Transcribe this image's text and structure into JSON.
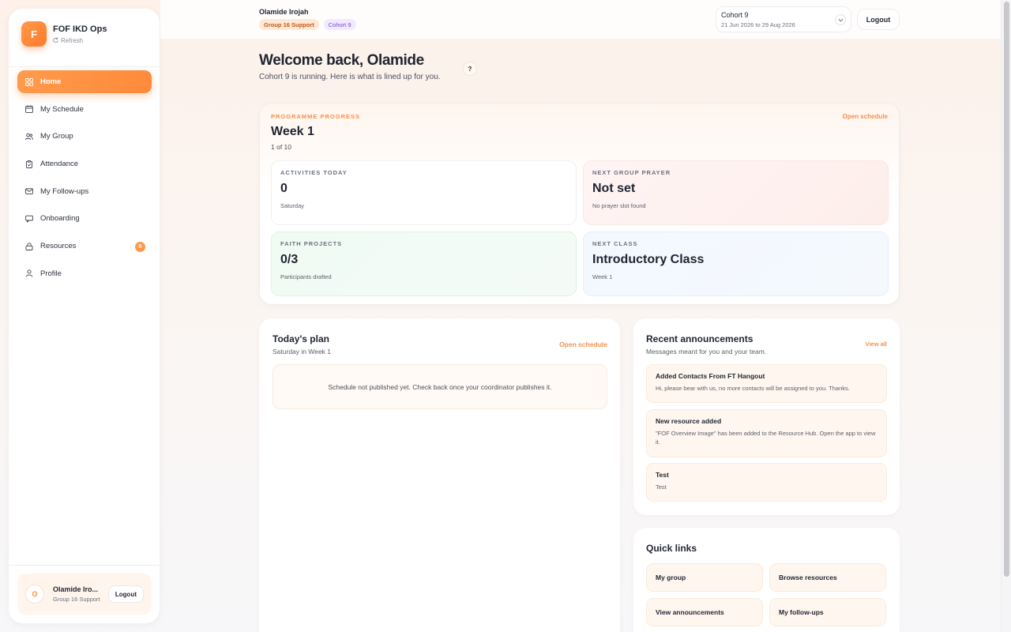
{
  "brand": {
    "logo_letter": "F",
    "name": "FOF IKD Ops",
    "refresh_label": "Refresh"
  },
  "sidebar": {
    "items": [
      {
        "label": "Home",
        "icon": "grid-icon",
        "active": true
      },
      {
        "label": "My Schedule",
        "icon": "calendar-icon"
      },
      {
        "label": "My Group",
        "icon": "users-icon"
      },
      {
        "label": "Attendance",
        "icon": "clipboard-icon"
      },
      {
        "label": "My Follow-ups",
        "icon": "mail-icon"
      },
      {
        "label": "Onboarding",
        "icon": "chat-icon"
      },
      {
        "label": "Resources",
        "icon": "lock-icon",
        "badge": "6"
      },
      {
        "label": "Profile",
        "icon": "person-icon"
      }
    ]
  },
  "sidebar_user": {
    "avatar": "O",
    "name": "Olamide Iro...",
    "role": "Group 16 Support",
    "logout_label": "Logout"
  },
  "header": {
    "user_name": "Olamide Irojah",
    "group_chip": "Group 16 Support",
    "cohort_chip": "Cohort 9",
    "cohort_select": {
      "name": "Cohort 9",
      "dates": "21 Jun 2026 to 29 Aug 2026"
    },
    "logout_label": "Logout"
  },
  "welcome": {
    "title": "Welcome back, Olamide",
    "subtitle": "Cohort 9 is running. Here is what is lined up for you.",
    "help": "?"
  },
  "progress": {
    "eyebrow": "PROGRAMME PROGRESS",
    "week": "Week 1",
    "count": "1 of 10",
    "link": "Open schedule",
    "stats": [
      {
        "label": "ACTIVITIES TODAY",
        "value": "0",
        "note": "Saturday"
      },
      {
        "label": "NEXT GROUP PRAYER",
        "value": "Not set",
        "note": "No prayer slot found"
      },
      {
        "label": "FAITH PROJECTS",
        "value": "0/3",
        "note": "Participants drafted"
      },
      {
        "label": "NEXT CLASS",
        "value": "Introductory Class",
        "note": "Week 1"
      }
    ]
  },
  "plan": {
    "title": "Today's plan",
    "subtitle": "Saturday in Week 1",
    "link": "Open schedule",
    "empty": "Schedule not published yet. Check back once your coordinator publishes it."
  },
  "announcements": {
    "title": "Recent announcements",
    "subtitle": "Messages meant for you and your team.",
    "link": "View all",
    "items": [
      {
        "title": "Added Contacts From FT Hangout",
        "body": "Hi, please bear with us, no more contacts will be assigned to you. Thanks."
      },
      {
        "title": "New resource added",
        "body": "\"FOF Overview Image\" has been added to the Resource Hub. Open the app to view it."
      },
      {
        "title": "Test",
        "body": "Test"
      }
    ]
  },
  "quick_links": {
    "title": "Quick links",
    "items": [
      "My group",
      "Browse resources",
      "View announcements",
      "My follow-ups"
    ]
  },
  "colors": {
    "accent": "#ff8a3a",
    "accent_light": "#fff7ef",
    "text": "#1f2430"
  }
}
